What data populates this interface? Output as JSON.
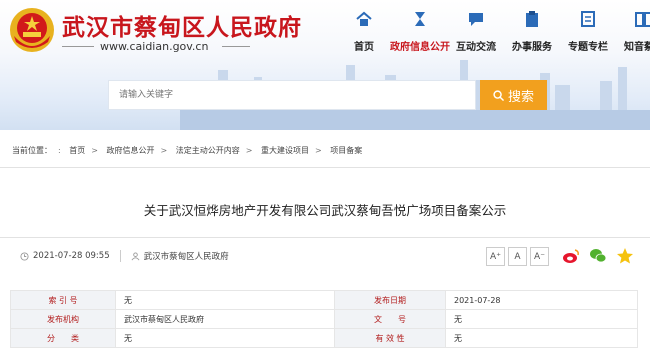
{
  "site": {
    "title": "武汉市蔡甸区人民政府",
    "url": "www.caidian.gov.cn"
  },
  "nav": [
    {
      "label": "首页",
      "icon": "home-icon"
    },
    {
      "label": "政府信息公开",
      "icon": "hourglass-icon"
    },
    {
      "label": "互动交流",
      "icon": "chat-icon"
    },
    {
      "label": "办事服务",
      "icon": "clipboard-icon"
    },
    {
      "label": "专题专栏",
      "icon": "document-icon"
    },
    {
      "label": "知音蔡甸",
      "icon": "book-icon"
    }
  ],
  "search": {
    "placeholder": "请输入关键字",
    "button": "搜索"
  },
  "breadcrumb": {
    "prefix": "当前位置：",
    "items": [
      "首页",
      "政府信息公开",
      "法定主动公开内容",
      "重大建设项目",
      "项目备案"
    ]
  },
  "article": {
    "title": "关于武汉恒烨房地产开发有限公司武汉蔡甸吾悦广场项目备案公示",
    "date": "2021-07-28 09:55",
    "source": "武汉市蔡甸区人民政府"
  },
  "font_sizes": [
    "A⁺",
    "A",
    "A⁻"
  ],
  "share": [
    "weibo-icon",
    "wechat-icon",
    "star-icon"
  ],
  "info_table": {
    "rows": [
      {
        "k1": "索 引 号",
        "v1": "无",
        "k2": "发布日期",
        "v2": "2021-07-28"
      },
      {
        "k1": "发布机构",
        "v1": "武汉市蔡甸区人民政府",
        "k2": "文　　号",
        "v2": "无"
      },
      {
        "k1": "分　　类",
        "v1": "无",
        "k2": "有 效 性",
        "v2": "无"
      }
    ]
  },
  "colors": {
    "brand_red": "#c8161d",
    "search_orange": "#f2a01e"
  }
}
